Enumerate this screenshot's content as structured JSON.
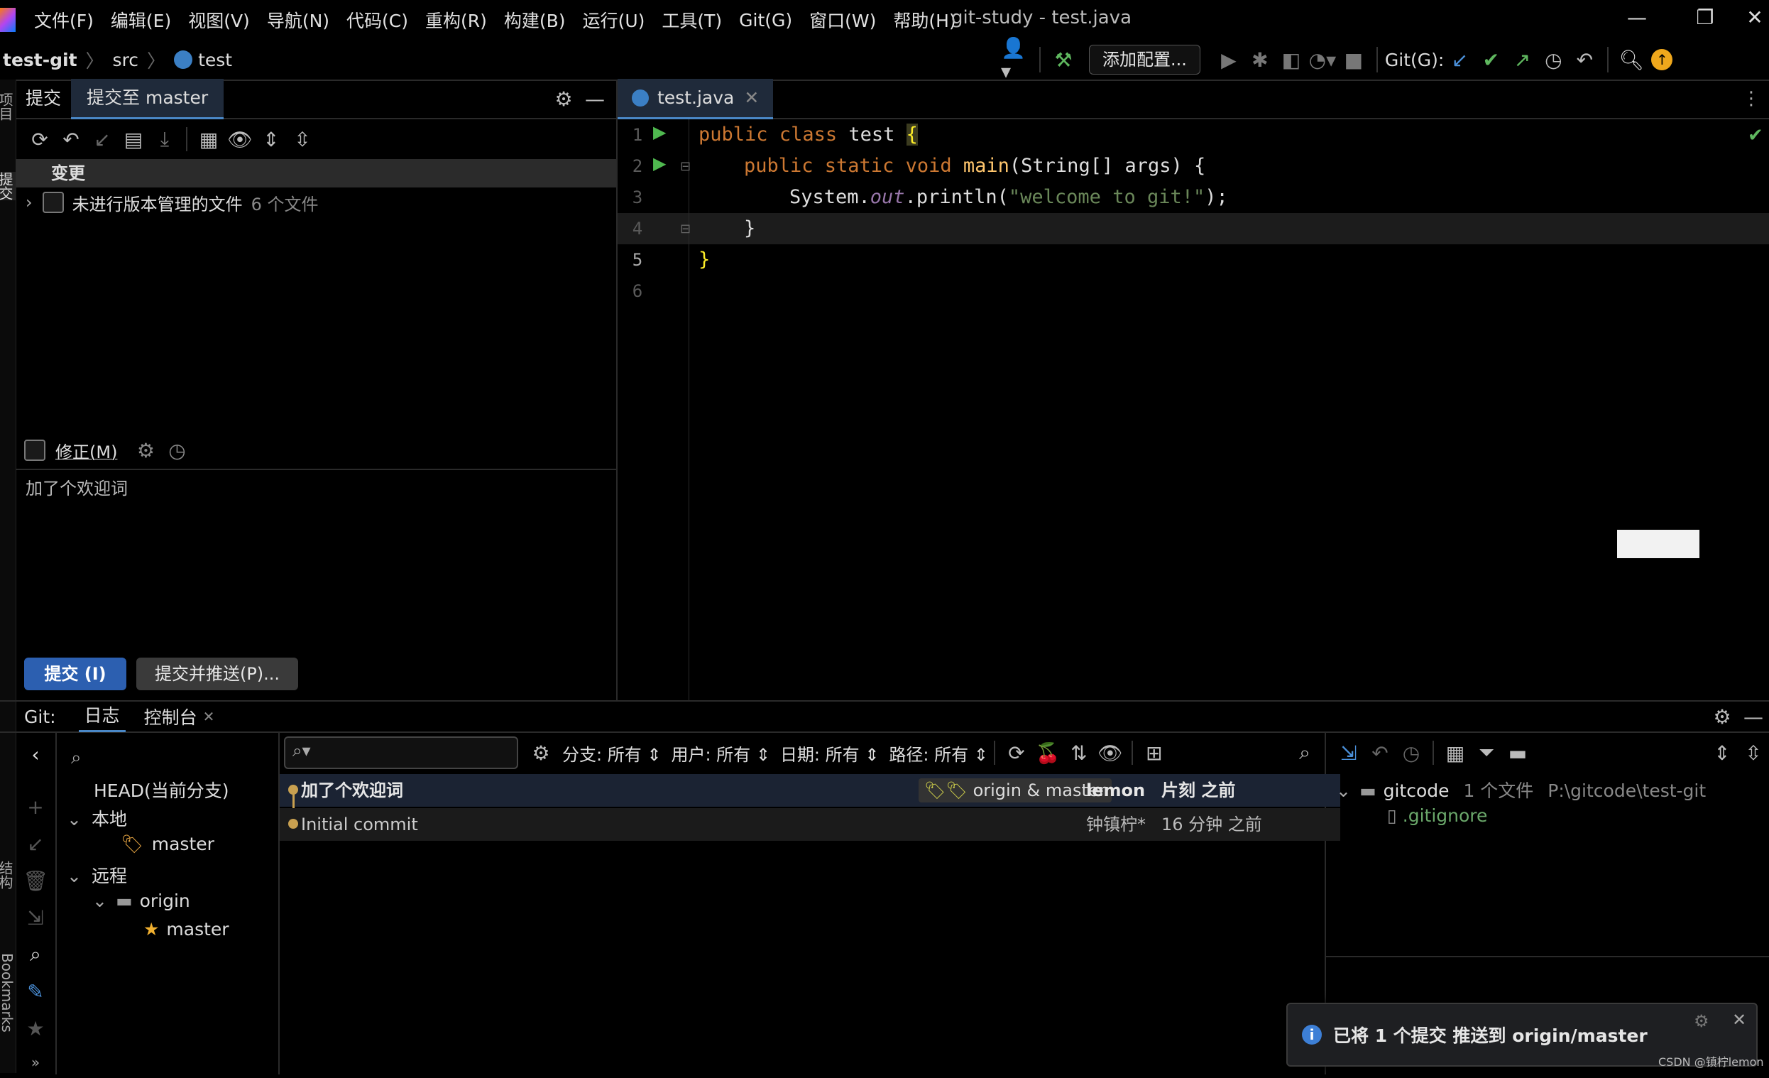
{
  "menubar": {
    "items": [
      "文件(F)",
      "编辑(E)",
      "视图(V)",
      "导航(N)",
      "代码(C)",
      "重构(R)",
      "构建(B)",
      "运行(U)",
      "工具(T)",
      "Git(G)",
      "窗口(W)",
      "帮助(H)"
    ],
    "window_title": "git-study - test.java"
  },
  "navbar": {
    "breadcrumb": [
      "test-git",
      "src",
      "test"
    ],
    "run_config": "添加配置...",
    "git_label": "Git(G):"
  },
  "leftstrip": {
    "project": "项目",
    "commit": "提交",
    "structure": "结构",
    "bookmarks": "Bookmarks"
  },
  "commit_panel": {
    "tabs": [
      "提交",
      "提交至 master"
    ],
    "changes_header": "变更",
    "unversioned_label": "未进行版本管理的文件",
    "unversioned_count": "6 个文件",
    "amend_label": "修正(M)",
    "message": "加了个欢迎词",
    "commit_button": "提交 (I)",
    "commit_push_button": "提交并推送(P)..."
  },
  "editor": {
    "tab_label": "test.java",
    "lines": [
      "1",
      "2",
      "3",
      "4",
      "5",
      "6"
    ],
    "code": {
      "l1_kw1": "public",
      "l1_kw2": "class",
      "l1_name": " test ",
      "l1_brace": "{",
      "l2_kw": "public static void",
      "l2_fn": "main",
      "l2_rest": "(String[] args) {",
      "l3_a": "System.",
      "l3_b": "out",
      "l3_c": ".println(",
      "l3_str": "\"welcome to git!\"",
      "l3_d": ");",
      "l4": "}",
      "l5": "}"
    }
  },
  "git_panel": {
    "title": "Git:",
    "tabs": [
      "日志",
      "控制台"
    ],
    "branches": {
      "head": "HEAD(当前分支)",
      "local": "本地",
      "local_master": "master",
      "remote": "远程",
      "origin": "origin",
      "remote_master": "master"
    },
    "filters": {
      "branch": "分支: 所有",
      "user": "用户: 所有",
      "date": "日期: 所有",
      "path": "路径: 所有"
    },
    "log": [
      {
        "message": "加了个欢迎词",
        "refs": "origin & master",
        "author": "lemon",
        "time": "片刻 之前"
      },
      {
        "message": "Initial commit",
        "refs": "",
        "author": "钟镇柠*",
        "time": "16 分钟 之前"
      }
    ],
    "details": {
      "root_label": "gitcode",
      "root_count": "1 个文件",
      "root_path": "P:\\gitcode\\test-git",
      "file": ".gitignore"
    }
  },
  "notification": {
    "text": "已将 1 个提交 推送到 origin/master"
  },
  "watermark": "CSDN @镇柠lemon"
}
